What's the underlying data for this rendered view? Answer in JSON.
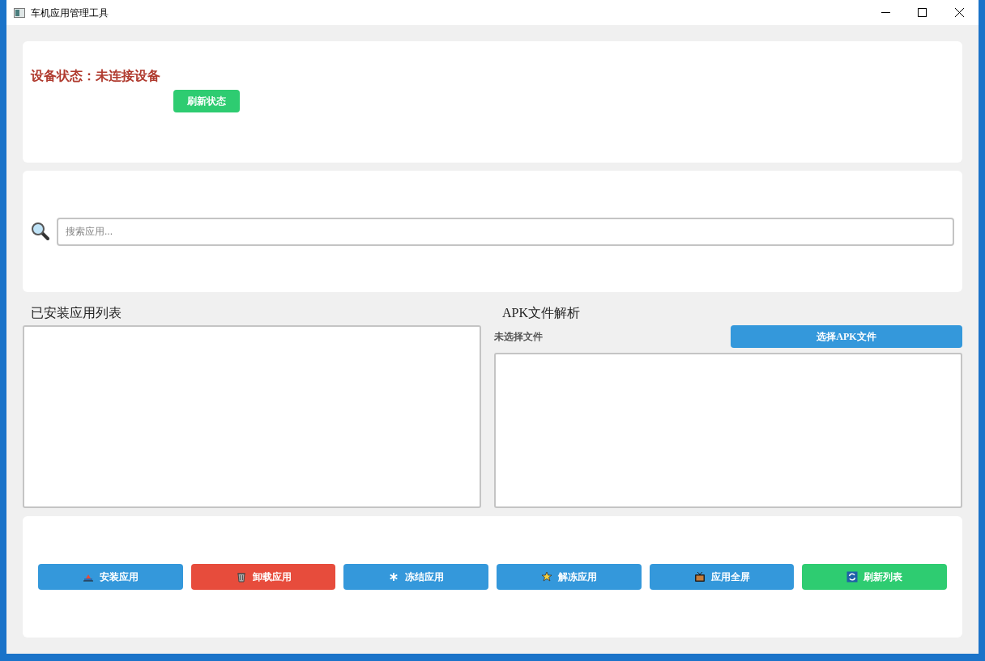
{
  "window": {
    "title": "车机应用管理工具"
  },
  "device_status": {
    "text": "设备状态：未连接设备",
    "refresh_button": "刷新状态"
  },
  "search": {
    "placeholder": "搜索应用..."
  },
  "installed_apps": {
    "title": "已安装应用列表"
  },
  "apk_parse": {
    "title": "APK文件解析",
    "file_label": "未选择文件",
    "select_button": "选择APK文件"
  },
  "actions": [
    {
      "label": "安装应用",
      "kind": "install",
      "color": "#3498db"
    },
    {
      "label": "卸载应用",
      "kind": "trash",
      "color": "#e74c3c"
    },
    {
      "label": "冻结应用",
      "kind": "freeze",
      "color": "#3498db"
    },
    {
      "label": "解冻应用",
      "kind": "thaw",
      "color": "#3498db"
    },
    {
      "label": "应用全屏",
      "kind": "tv",
      "color": "#3498db"
    },
    {
      "label": "刷新列表",
      "kind": "refresh",
      "color": "#2ecc71"
    }
  ]
}
